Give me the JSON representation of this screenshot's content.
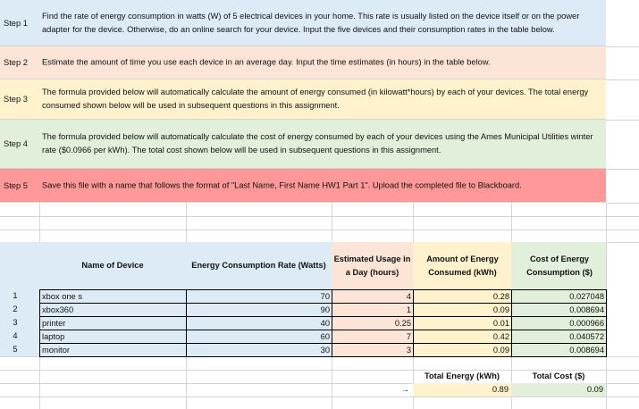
{
  "steps": [
    {
      "label": "Step 1",
      "text": "Find the rate of energy consumption in watts (W) of 5 electrical devices in your home.  This rate is usually listed on the device itself or on the power adapter for the device.  Otherwise, do an online search for your device.  Input the five devices and their consumption rates in the table below.",
      "color": "#ddebf7"
    },
    {
      "label": "Step 2",
      "text": "Estimate the amount of time you use each device in an average day.  Input the time estimates (in hours) in the table below.",
      "color": "#fce4d6"
    },
    {
      "label": "Step 3",
      "text": "The formula provided below will automatically calculate the amount of energy consumed (in kilowatt*hours) by each of your devices.  The total energy consumed shown below will be used in subsequent questions in this assignment.",
      "color": "#fff2cc"
    },
    {
      "label": "Step 4",
      "text": "The formula provided below will automatically calculate the cost of energy consumed by each of your devices using the Ames Municipal Utilities winter rate ($0.0966 per kWh).  The total cost shown below will be used in subsequent questions in this assignment.",
      "color": "#e2efda"
    },
    {
      "label": "Step 5",
      "text": "Save this file with a name that follows the format of \"Last Name, First Name HW1 Part 1\".  Upload the completed file to Blackboard.",
      "color": "#ff9999"
    }
  ],
  "table": {
    "headers": {
      "name": "Name of Device",
      "rate": "Energy Consumption Rate (Watts)",
      "usage": "Estimated Usage in a Day (hours)",
      "energy": "Amount of Energy Consumed (kWh)",
      "cost": "Cost of Energy Consumption ($)"
    },
    "rows": [
      {
        "n": "1",
        "name": "xbox one s",
        "rate": "70",
        "usage": "4",
        "energy": "0.28",
        "cost": "0.027048"
      },
      {
        "n": "2",
        "name": "xbox360",
        "rate": "90",
        "usage": "1",
        "energy": "0.09",
        "cost": "0.008694"
      },
      {
        "n": "3",
        "name": "printer",
        "rate": "40",
        "usage": "0.25",
        "energy": "0.01",
        "cost": "0.000966"
      },
      {
        "n": "4",
        "name": "laptop",
        "rate": "60",
        "usage": "7",
        "energy": "0.42",
        "cost": "0.040572"
      },
      {
        "n": "5",
        "name": "monitor",
        "rate": "30",
        "usage": "3",
        "energy": "0.09",
        "cost": "0.008694"
      }
    ]
  },
  "totals": {
    "energy_label": "Total Energy (kWh)",
    "cost_label": "Total Cost ($)",
    "arrow": "→",
    "energy": "0.89",
    "cost": "0.09"
  }
}
